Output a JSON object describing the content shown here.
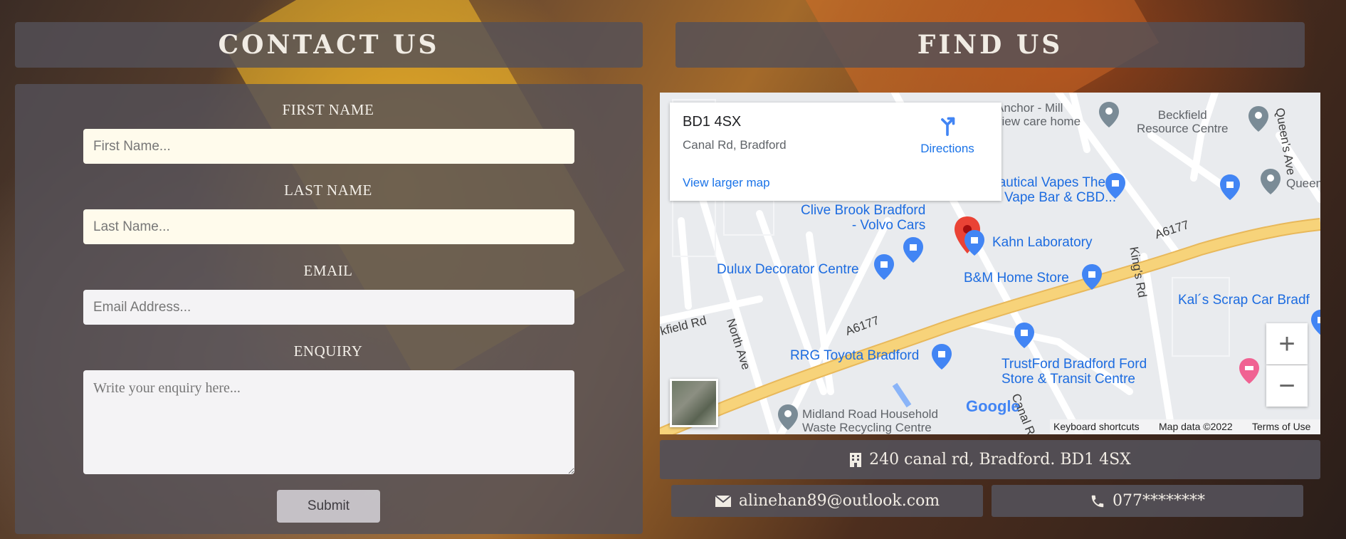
{
  "contact": {
    "heading": "CONTACT US",
    "first_name_label": "FIRST NAME",
    "first_name_placeholder": "First Name...",
    "last_name_label": "LAST NAME",
    "last_name_placeholder": "Last Name...",
    "email_label": "EMAIL",
    "email_placeholder": "Email Address...",
    "enquiry_label": "ENQUIRY",
    "enquiry_placeholder": "Write your enquiry here...",
    "submit_label": "Submit"
  },
  "find": {
    "heading": "FIND US",
    "address": "240 canal rd, Bradford. BD1 4SX",
    "email": "alinehan89@outlook.com",
    "phone": "077********"
  },
  "map": {
    "card_title": "BD1 4SX",
    "card_subtitle": "Canal Rd, Bradford",
    "directions": "Directions",
    "view_larger": "View larger map",
    "places": {
      "anchor_mill": "Anchor - Mill",
      "anchor_mill_2": "view care home",
      "beckfield": "Beckfield",
      "beckfield_2": "Resource Centre",
      "queens": "Queens",
      "nautical": "Nautical Vapes The",
      "nautical_2": "Vape Bar & CBD...",
      "clive_brook": "Clive Brook Bradford",
      "clive_brook_2": "- Volvo Cars",
      "kahn": "Kahn Laboratory",
      "dulux": "Dulux Decorator Centre",
      "bm": "B&M Home Store",
      "kals": "Kal´s Scrap Car Bradf",
      "rrg": "RRG Toyota Bradford",
      "trustford": "TrustFord Bradford Ford",
      "trustford_2": "Store & Transit Centre",
      "midland": "Midland Road Household",
      "midland_2": "Waste Recycling Centre",
      "road_a6177_1": "A6177",
      "road_a6177_2": "A6177",
      "kings_rd": "King's Rd",
      "north_ave": "North Ave",
      "canal_rd": "Canal Rd",
      "queens_ave": "Queen's Ave",
      "field_rd": "kfield Rd"
    },
    "zoom_in": "+",
    "zoom_out": "−",
    "google": "Google",
    "keyboard": "Keyboard shortcuts",
    "map_data": "Map data ©2022",
    "terms": "Terms of Use"
  },
  "colors": {
    "panel": "#545058",
    "heading_text": "#f1ece4",
    "map_link": "#1d6ce0",
    "road_major": "#f7d37a",
    "marker_red": "#ea4335"
  },
  "icons": {
    "address": "building-icon",
    "email": "envelope-icon",
    "phone": "phone-icon",
    "directions": "directions-arrow-icon"
  }
}
